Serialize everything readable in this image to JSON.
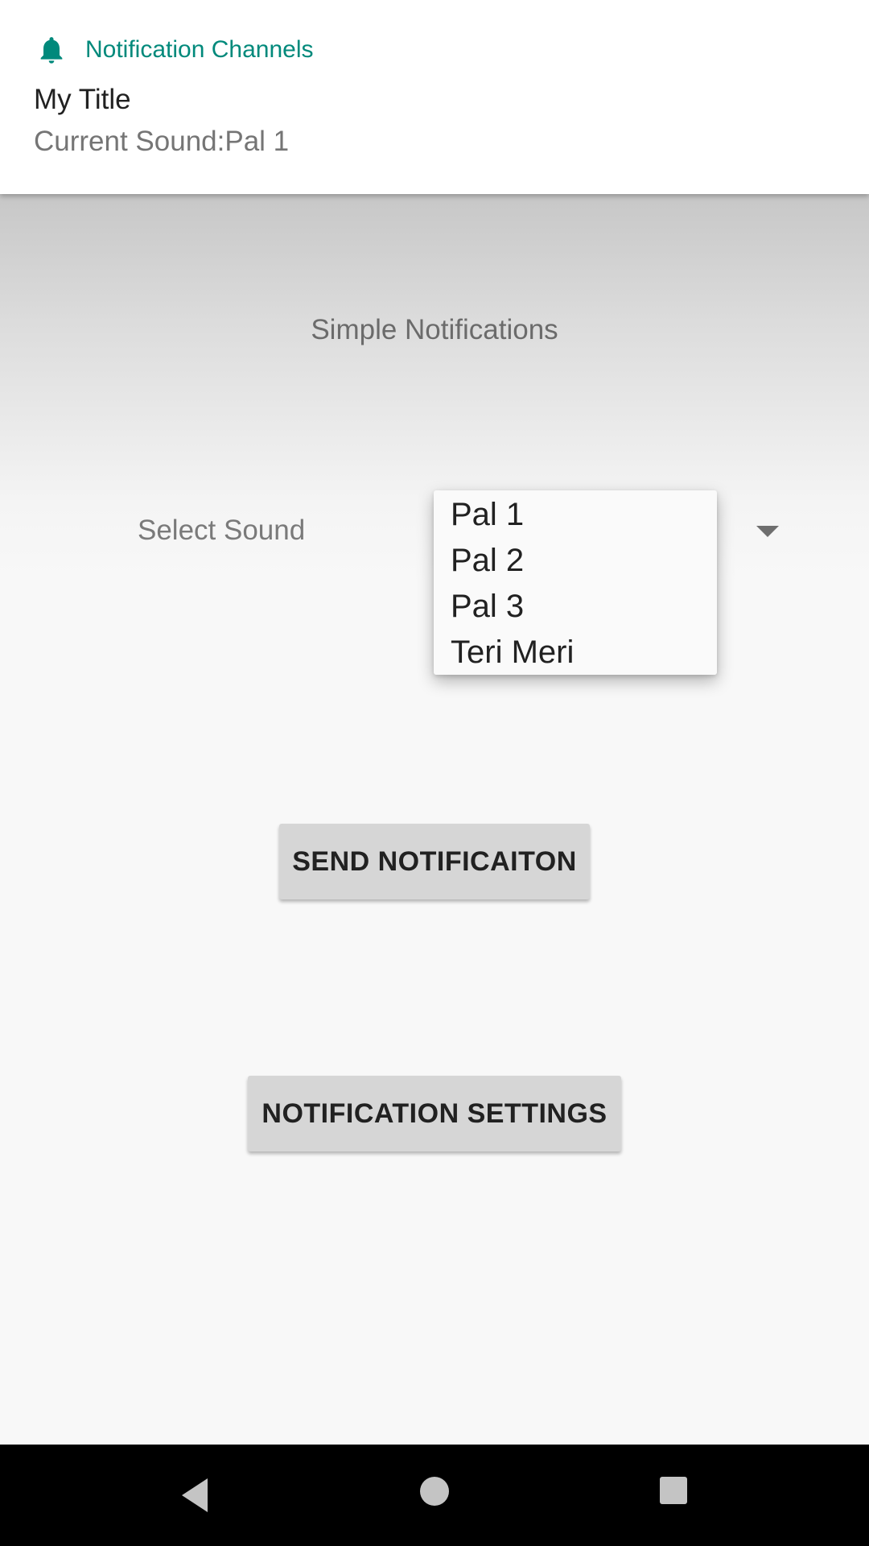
{
  "notification": {
    "app_name": "Notification Channels",
    "icon": "bell-icon",
    "accent_color": "#00897b",
    "title": "My Title",
    "text": "Current Sound:Pal 1"
  },
  "main": {
    "heading": "Simple Notifications",
    "select_label": "Select Sound",
    "sound_options": [
      "Pal 1",
      "Pal 2",
      "Pal 3",
      "Teri Meri"
    ],
    "send_button": "SEND NOTIFICAITON",
    "settings_button": "NOTIFICATION SETTINGS"
  },
  "navbar": {
    "back_icon": "back-triangle-icon",
    "home_icon": "home-circle-icon",
    "recents_icon": "recents-square-icon"
  }
}
